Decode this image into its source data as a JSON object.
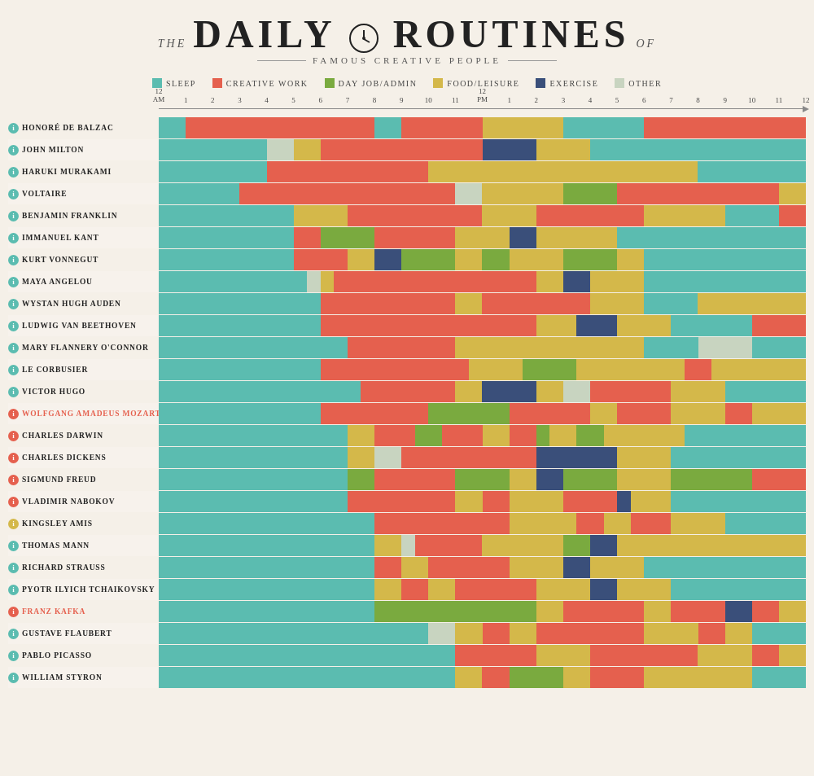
{
  "header": {
    "the": "THE",
    "title": "DAILY ROUTINES",
    "of": "OF",
    "subtitle": "FAMOUS CREATIVE PEOPLE"
  },
  "legend": {
    "items": [
      {
        "label": "SLEEP",
        "color": "#5bbcb0",
        "class": "c-sleep"
      },
      {
        "label": "CREATIVE WORK",
        "color": "#e5604e",
        "class": "c-creative"
      },
      {
        "label": "DAY JOB/ADMIN",
        "color": "#7aaa3f",
        "class": "c-dayjob"
      },
      {
        "label": "FOOD/LEISURE",
        "color": "#d4b84a",
        "class": "c-food"
      },
      {
        "label": "EXERCISE",
        "color": "#3a4f7a",
        "class": "c-exercise"
      },
      {
        "label": "OTHER",
        "color": "#c8d4c0",
        "class": "c-other"
      }
    ]
  },
  "timeLabels": [
    "12\nAM",
    "1",
    "2",
    "3",
    "4",
    "5",
    "6",
    "7",
    "8",
    "9",
    "10",
    "11",
    "12\nPM",
    "1",
    "2",
    "3",
    "4",
    "5",
    "6",
    "7",
    "8",
    "9",
    "10",
    "11",
    "12"
  ],
  "people": [
    {
      "name": "HONORÉ DE BALZAC",
      "infoColor": "c-sleep"
    },
    {
      "name": "JOHN MILTON",
      "infoColor": "c-sleep"
    },
    {
      "name": "HARUKI MURAKAMI",
      "infoColor": "c-sleep"
    },
    {
      "name": "VOLTAIRE",
      "infoColor": "c-sleep"
    },
    {
      "name": "BENJAMIN FRANKLIN",
      "infoColor": "c-sleep"
    },
    {
      "name": "IMMANUEL KANT",
      "infoColor": "c-sleep"
    },
    {
      "name": "KURT VONNEGUT",
      "infoColor": "c-sleep"
    },
    {
      "name": "MAYA ANGELOU",
      "infoColor": "c-sleep"
    },
    {
      "name": "WYSTAN HUGH AUDEN",
      "infoColor": "c-sleep"
    },
    {
      "name": "LUDWIG VAN BEETHOVEN",
      "infoColor": "c-sleep"
    },
    {
      "name": "MARY FLANNERY O'CONNOR",
      "infoColor": "c-sleep"
    },
    {
      "name": "LE CORBUSIER",
      "infoColor": "c-sleep"
    },
    {
      "name": "VICTOR HUGO",
      "infoColor": "c-sleep"
    },
    {
      "name": "WOLFGANG AMADEUS MOZART",
      "infoColor": "c-creative"
    },
    {
      "name": "CHARLES DARWIN",
      "infoColor": "c-creative"
    },
    {
      "name": "CHARLES DICKENS",
      "infoColor": "c-creative"
    },
    {
      "name": "SIGMUND FREUD",
      "infoColor": "c-creative"
    },
    {
      "name": "VLADIMIR NABOKOV",
      "infoColor": "c-creative"
    },
    {
      "name": "KINGSLEY AMIS",
      "infoColor": "c-food"
    },
    {
      "name": "THOMAS MANN",
      "infoColor": "c-sleep"
    },
    {
      "name": "RICHARD STRAUSS",
      "infoColor": "c-sleep"
    },
    {
      "name": "PYOTR ILYICH TCHAIKOVSKY",
      "infoColor": "c-sleep"
    },
    {
      "name": "FRANZ KAFKA",
      "infoColor": "c-creative"
    },
    {
      "name": "GUSTAVE FLAUBERT",
      "infoColor": "c-sleep"
    },
    {
      "name": "PABLO PICASSO",
      "infoColor": "c-sleep"
    },
    {
      "name": "WILLIAM STYRON",
      "infoColor": "c-sleep"
    }
  ]
}
